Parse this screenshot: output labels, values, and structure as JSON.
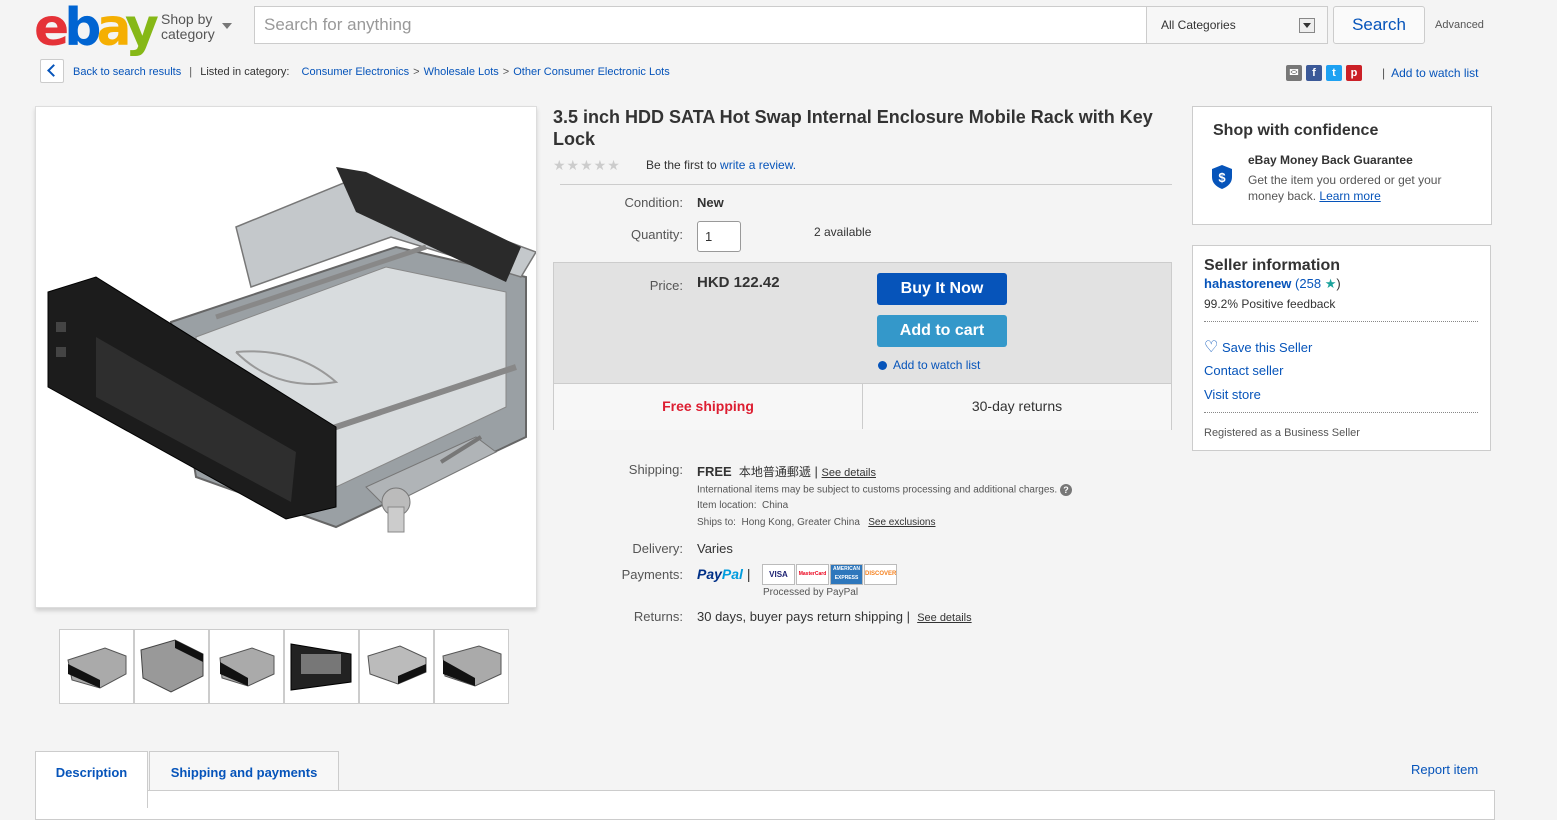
{
  "header": {
    "logo_letters": [
      "e",
      "b",
      "a",
      "y"
    ],
    "shop_by_line1": "Shop by",
    "shop_by_line2": "category",
    "search_placeholder": "Search for anything",
    "category_selected": "All Categories",
    "search_button": "Search",
    "advanced_link": "Advanced"
  },
  "breadcrumb": {
    "back": "Back to search results",
    "listed_in": "Listed in category:",
    "categories": [
      "Consumer Electronics",
      "Wholesale Lots",
      "Other Consumer Electronic Lots"
    ],
    "separator": ">",
    "watch_list": "Add to watch list"
  },
  "share_icons": [
    "email-icon",
    "facebook-icon",
    "twitter-icon",
    "pinterest-icon"
  ],
  "product": {
    "title": "3.5 inch HDD SATA Hot Swap Internal Enclosure Mobile Rack with Key Lock",
    "rating_stars": 0,
    "rating_text": "Be the first to",
    "rating_link": "write a review.",
    "condition_label": "Condition:",
    "condition_value": "New",
    "quantity_label": "Quantity:",
    "quantity_value": "1",
    "available": "2 available",
    "price_label": "Price:",
    "price_value": "HKD 122.42",
    "buy_now": "Buy It Now",
    "add_to_cart": "Add to cart",
    "add_watch": "Add to watch list",
    "free_shipping": "Free shipping",
    "returns_badge": "30-day returns"
  },
  "details": {
    "shipping_label": "Shipping:",
    "shipping_free": "FREE",
    "shipping_method": "本地普通郵遞",
    "see_details": "See details",
    "intl_note": "International items may be subject to customs processing and additional charges.",
    "item_location_label": "Item location:",
    "item_location": "China",
    "ships_to_label": "Ships to:",
    "ships_to": "Hong Kong, Greater China",
    "see_exclusions": "See exclusions",
    "delivery_label": "Delivery:",
    "delivery_value": "Varies",
    "payments_label": "Payments:",
    "paypal_a": "Pay",
    "paypal_b": "Pal",
    "cards": [
      "VISA",
      "MasterCard",
      "AMERICAN EXPRESS",
      "DISCOVER"
    ],
    "processed_by": "Processed by PayPal",
    "returns_label": "Returns:",
    "returns_value": "30 days, buyer pays return shipping",
    "returns_link": "See details"
  },
  "confidence": {
    "title": "Shop with confidence",
    "guarantee_title": "eBay Money Back Guarantee",
    "guarantee_text1": "Get the item you ordered or get your",
    "guarantee_text2": "money back.",
    "learn_more": "Learn more"
  },
  "seller": {
    "title": "Seller information",
    "name": "hahastorenew",
    "score": "(258",
    "score_close": ")",
    "feedback": "99.2% Positive feedback",
    "save": "Save this Seller",
    "contact": "Contact seller",
    "visit": "Visit store",
    "registered": "Registered as a Business Seller"
  },
  "tabs": {
    "description": "Description",
    "shipping_payments": "Shipping and payments",
    "report": "Report item"
  },
  "colors": {
    "ebay_red": "#e53238",
    "ebay_blue": "#0064d2",
    "ebay_yellow": "#f5af02",
    "ebay_green": "#86b817",
    "link_blue": "#0654ba",
    "free_shipping_red": "#dd1e31"
  }
}
